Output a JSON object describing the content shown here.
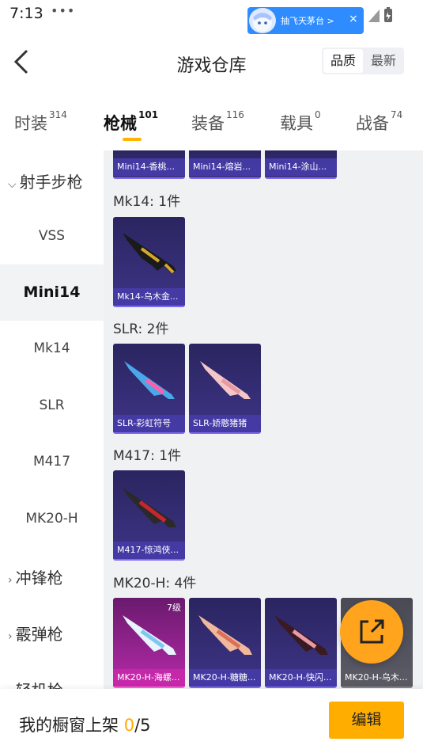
{
  "status": {
    "time": "7:13",
    "dots": "•••"
  },
  "promo": {
    "text": "抽飞天茅台 >",
    "close": "×"
  },
  "header": {
    "title": "游戏仓库",
    "sort_quality": "品质",
    "sort_newest": "最新"
  },
  "tabs": [
    {
      "label": "时装",
      "count": "314"
    },
    {
      "label": "枪械",
      "count": "101"
    },
    {
      "label": "装备",
      "count": "116"
    },
    {
      "label": "载具",
      "count": "0"
    },
    {
      "label": "战备",
      "count": "74"
    }
  ],
  "sidebar": {
    "group_sniper": "射手步枪",
    "items": [
      "VSS",
      "Mini14",
      "Mk14",
      "SLR",
      "M417",
      "MK20-H"
    ],
    "group_smg": "冲锋枪",
    "group_shotgun": "霰弹枪",
    "group_lmg": "轻机枪"
  },
  "content": {
    "top_cards": [
      "Mini14-香桃...",
      "Mini14-熔岩...",
      "Mini14-涂山..."
    ],
    "sections": [
      {
        "title": "Mk14: 1件",
        "cards": [
          "Mk14-乌木金..."
        ]
      },
      {
        "title": "SLR: 2件",
        "cards": [
          "SLR-彩虹符号",
          "SLR-娇憨猪猪"
        ]
      },
      {
        "title": "M417: 1件",
        "cards": [
          "M417-惊鸿侠..."
        ]
      },
      {
        "title": "MK20-H: 4件",
        "cards": [
          "MK20-H-海螺...",
          "MK20-H-糖糖...",
          "MK20-H-快闪...",
          "MK20-H-乌木..."
        ],
        "first_level": "7级"
      }
    ]
  },
  "bottom": {
    "label": "我的橱窗上架 ",
    "count": "0",
    "total": "/5",
    "edit": "编辑"
  },
  "colors": {
    "accent": "#ffae00",
    "card_bg": "#3e3486",
    "card_pink": "#b42aa8"
  }
}
